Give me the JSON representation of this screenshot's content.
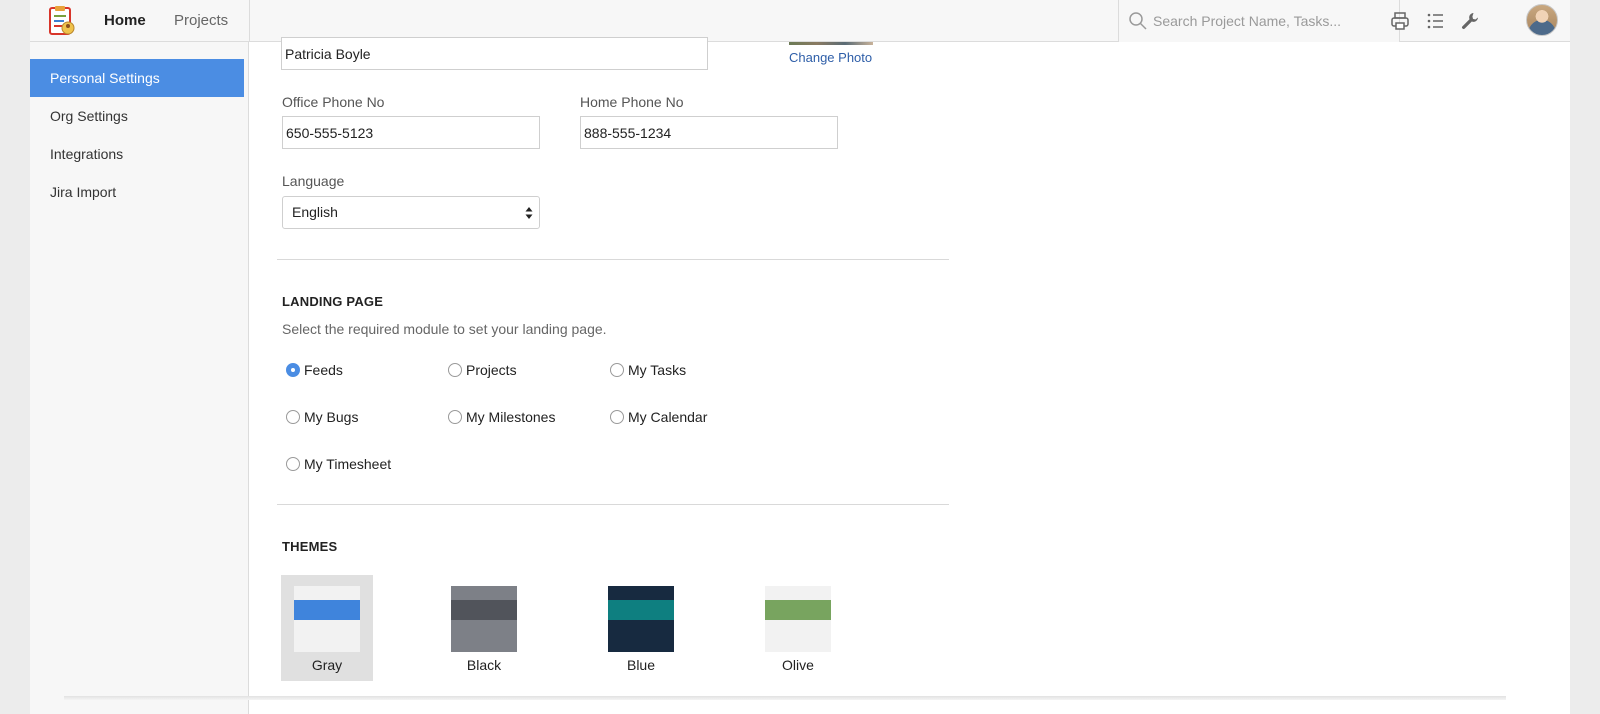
{
  "header": {
    "nav": {
      "home": "Home",
      "projects": "Projects"
    },
    "search": {
      "placeholder": "Search Project Name, Tasks..."
    },
    "icons": [
      "print-icon",
      "list-icon",
      "wrench-icon"
    ]
  },
  "sidebar": {
    "items": [
      {
        "label": "Personal Settings",
        "active": true
      },
      {
        "label": "Org Settings",
        "active": false
      },
      {
        "label": "Integrations",
        "active": false
      },
      {
        "label": "Jira Import",
        "active": false
      }
    ]
  },
  "profile": {
    "name_value": "Patricia Boyle",
    "change_photo": "Change Photo",
    "office_phone": {
      "label": "Office Phone No",
      "value": "650-555-5123"
    },
    "home_phone": {
      "label": "Home Phone No",
      "value": "888-555-1234"
    },
    "language": {
      "label": "Language",
      "value": "English"
    }
  },
  "landing_page": {
    "title": "LANDING PAGE",
    "description": "Select the required module to set your landing page.",
    "options": [
      {
        "label": "Feeds",
        "checked": true
      },
      {
        "label": "Projects",
        "checked": false
      },
      {
        "label": "My Tasks",
        "checked": false
      },
      {
        "label": "My Bugs",
        "checked": false
      },
      {
        "label": "My Milestones",
        "checked": false
      },
      {
        "label": "My Calendar",
        "checked": false
      },
      {
        "label": "My Timesheet",
        "checked": false
      }
    ]
  },
  "themes": {
    "title": "THEMES",
    "items": [
      {
        "label": "Gray",
        "selected": true,
        "colors": {
          "top": "#f2f2f2",
          "mid": "#3f84dc",
          "bot": "#f2f2f2"
        }
      },
      {
        "label": "Black",
        "selected": false,
        "colors": {
          "top": "#7d8087",
          "mid": "#51545b",
          "bot": "#7d8087"
        }
      },
      {
        "label": "Blue",
        "selected": false,
        "colors": {
          "top": "#172a40",
          "mid": "#0e7f80",
          "bot": "#172a40"
        }
      },
      {
        "label": "Olive",
        "selected": false,
        "colors": {
          "top": "#f2f2f2",
          "mid": "#78a45f",
          "bot": "#f2f2f2"
        }
      }
    ]
  },
  "colors": {
    "accent": "#4b8de3",
    "link": "#2e5ea8"
  }
}
